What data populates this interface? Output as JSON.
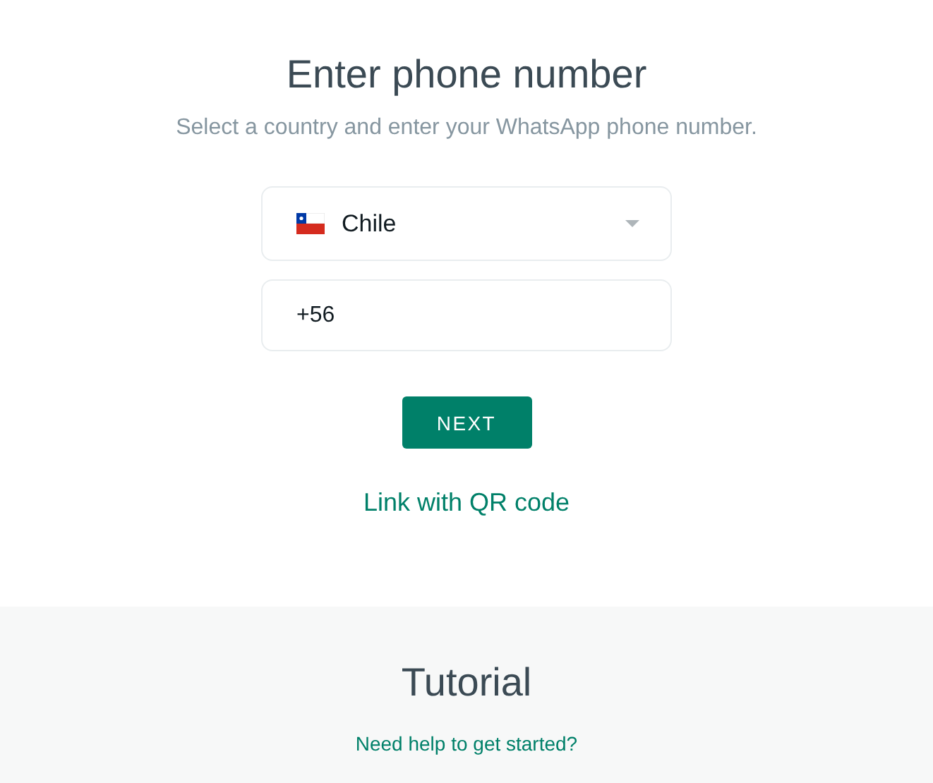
{
  "heading": "Enter phone number",
  "subtitle": "Select a country and enter your WhatsApp phone number.",
  "country_select": {
    "value": "Chile"
  },
  "phone_field": {
    "value": "+56"
  },
  "next_button": "NEXT",
  "qr_link": "Link with QR code",
  "tutorial": {
    "title": "Tutorial",
    "link": "Need help to get started?"
  }
}
